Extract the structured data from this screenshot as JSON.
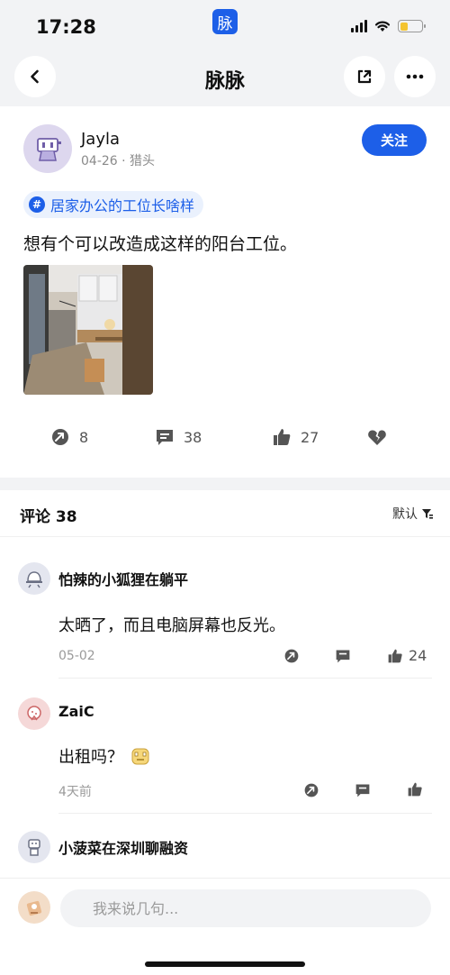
{
  "status_bar": {
    "time": "17:28",
    "app_badge": "脉",
    "battery_level": 0.35
  },
  "nav": {
    "title": "脉脉",
    "back_icon": "chevron-left-icon",
    "share_icon": "share-icon",
    "more_icon": "more-icon"
  },
  "post": {
    "author": "Jayla",
    "meta": "04-26 · 猎头",
    "follow_label": "关注",
    "topic_hash": "#",
    "topic": "居家办公的工位长啥样",
    "text": "想有个可以改造成这样的阳台工位。",
    "actions": {
      "forward_count": "8",
      "comment_count": "38",
      "like_count": "27"
    }
  },
  "comments": {
    "header_label": "评论 38",
    "sort_label": "默认",
    "items": [
      {
        "name": "怕辣的小狐狸在躺平",
        "text": "太晒了，而且电脑屏幕也反光。",
        "date": "05-02",
        "likes": "24"
      },
      {
        "name": "ZaiC",
        "text": "出租吗？",
        "date": "4天前",
        "likes": ""
      },
      {
        "name": "小菠菜在深圳聊融资",
        "text": "",
        "date": "",
        "likes": ""
      }
    ]
  },
  "input": {
    "placeholder": "我来说几句..."
  },
  "colors": {
    "accent": "#1d5fe8",
    "tag_bg": "#eaf1fd",
    "page_bg": "#f2f3f5"
  }
}
